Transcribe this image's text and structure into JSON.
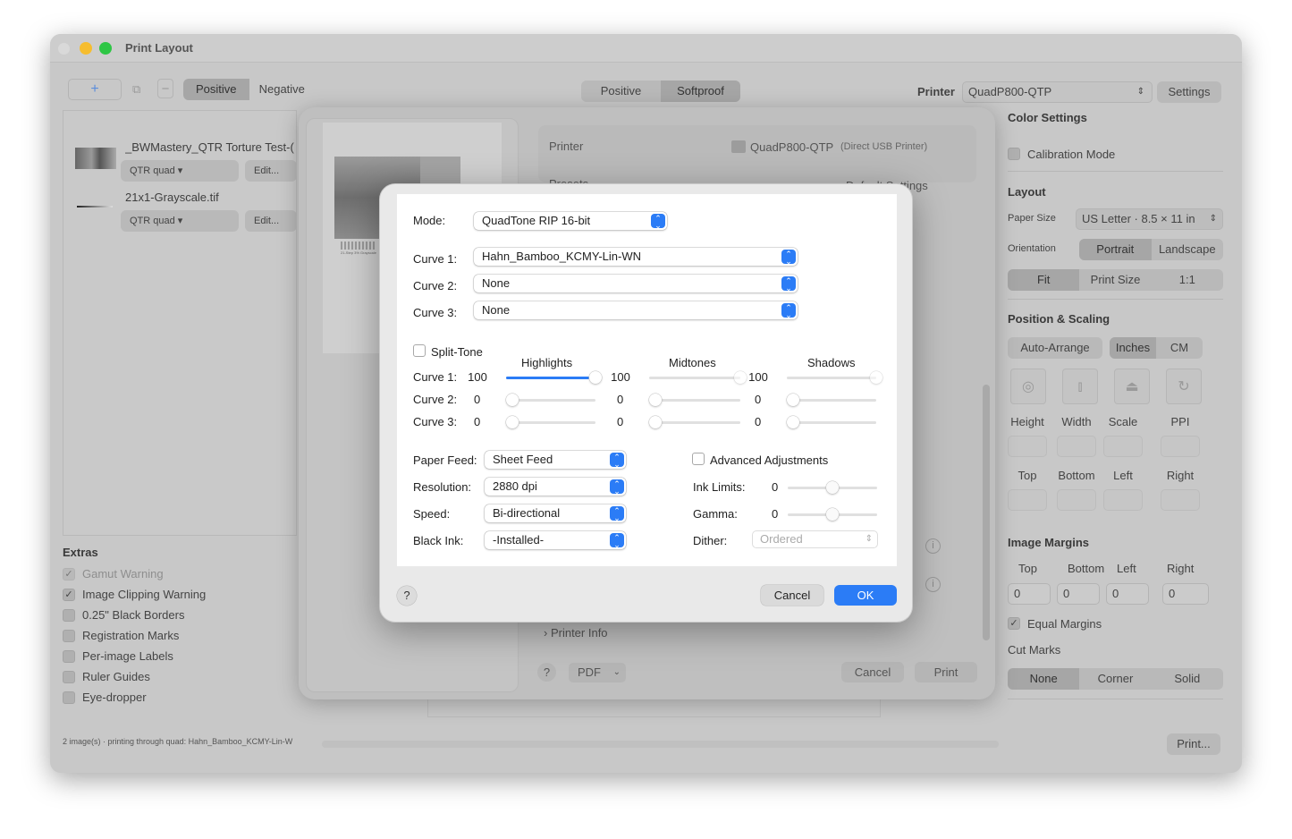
{
  "window": {
    "title": "Print Layout"
  },
  "toolbar": {
    "add": "+",
    "copy": "⧉",
    "minus": "−",
    "mode_tabs": [
      "Positive",
      "Negative"
    ],
    "view_tabs": [
      "Positive",
      "Softproof"
    ],
    "printer_label": "Printer",
    "printer_value": "QuadP800-QTP",
    "settings": "Settings"
  },
  "images": [
    {
      "name": "_BWMastery_QTR Torture Test-(",
      "quad": "QTR quad ▾",
      "edit": "Edit..."
    },
    {
      "name": "21x1-Grayscale.tif",
      "quad": "QTR quad ▾",
      "edit": "Edit..."
    }
  ],
  "extras": {
    "title": "Extras",
    "items": [
      {
        "label": "Gamut Warning",
        "checked": true,
        "disabled": true
      },
      {
        "label": "Image Clipping Warning",
        "checked": true,
        "disabled": false
      },
      {
        "label": "0.25\" Black Borders",
        "checked": false,
        "disabled": false
      },
      {
        "label": "Registration Marks",
        "checked": false,
        "disabled": false
      },
      {
        "label": "Per-image Labels",
        "checked": false,
        "disabled": false
      },
      {
        "label": "Ruler Guides",
        "checked": false,
        "disabled": false
      },
      {
        "label": "Eye-dropper",
        "checked": false,
        "disabled": false
      }
    ]
  },
  "status": "2 image(s) · printing through quad: Hahn_Bamboo_KCMY-Lin-W",
  "right": {
    "color_settings": "Color Settings",
    "calibration": "Calibration Mode",
    "layout": "Layout",
    "paper_size_label": "Paper Size",
    "paper_size": "US Letter · 8.5 × 11 in",
    "orientation_label": "Orientation",
    "orientation": [
      "Portrait",
      "Landscape"
    ],
    "fit": [
      "Fit",
      "Print Size",
      "1:1"
    ],
    "pos_scaling": "Position & Scaling",
    "auto_arrange": "Auto-Arrange",
    "units": [
      "Inches",
      "CM"
    ],
    "size_labels": [
      "Height",
      "Width",
      "Scale",
      "PPI"
    ],
    "edge_labels": [
      "Top",
      "Bottom",
      "Left",
      "Right"
    ],
    "image_margins": "Image Margins",
    "margin_labels": [
      "Top",
      "Bottom",
      "Left",
      "Right"
    ],
    "margin_values": [
      "0",
      "0",
      "0",
      "0"
    ],
    "equal_margins": "Equal Margins",
    "cut_marks": "Cut Marks",
    "cut_options": [
      "None",
      "Corner",
      "Solid"
    ],
    "print": "Print..."
  },
  "print_sheet": {
    "printer_label": "Printer",
    "printer_value": "QuadP800-QTP",
    "printer_note": "(Direct USB Printer)",
    "presets_label": "Presets",
    "presets_value": "Default Settings",
    "printer_info": "Printer Info",
    "help": "?",
    "pdf": "PDF",
    "cancel": "Cancel",
    "print": "Print",
    "preview_caption": "21-Step 3% Grayscale"
  },
  "dialog": {
    "mode_label": "Mode:",
    "mode": "QuadTone RIP 16-bit",
    "curves": [
      {
        "label": "Curve 1:",
        "value": "Hahn_Bamboo_KCMY-Lin-WN"
      },
      {
        "label": "Curve 2:",
        "value": "None"
      },
      {
        "label": "Curve 3:",
        "value": "None"
      }
    ],
    "split_tone": "Split-Tone",
    "columns": [
      "Highlights",
      "Midtones",
      "Shadows"
    ],
    "rows": [
      {
        "label": "Curve 1:",
        "values": [
          "100",
          "100",
          "100"
        ],
        "levels": [
          1,
          1,
          1
        ]
      },
      {
        "label": "Curve 2:",
        "values": [
          "0",
          "0",
          "0"
        ],
        "levels": [
          0,
          0,
          0
        ]
      },
      {
        "label": "Curve 3:",
        "values": [
          "0",
          "0",
          "0"
        ],
        "levels": [
          0,
          0,
          0
        ]
      }
    ],
    "paper_feed_label": "Paper Feed:",
    "paper_feed": "Sheet Feed",
    "resolution_label": "Resolution:",
    "resolution": "2880 dpi",
    "speed_label": "Speed:",
    "speed": "Bi-directional",
    "black_ink_label": "Black Ink:",
    "black_ink": "-Installed-",
    "advanced": "Advanced Adjustments",
    "ink_limits_label": "Ink Limits:",
    "ink_limits": "0",
    "gamma_label": "Gamma:",
    "gamma": "0",
    "dither_label": "Dither:",
    "dither": "Ordered",
    "help": "?",
    "cancel": "Cancel",
    "ok": "OK",
    "accent": "#2b7cf6"
  }
}
